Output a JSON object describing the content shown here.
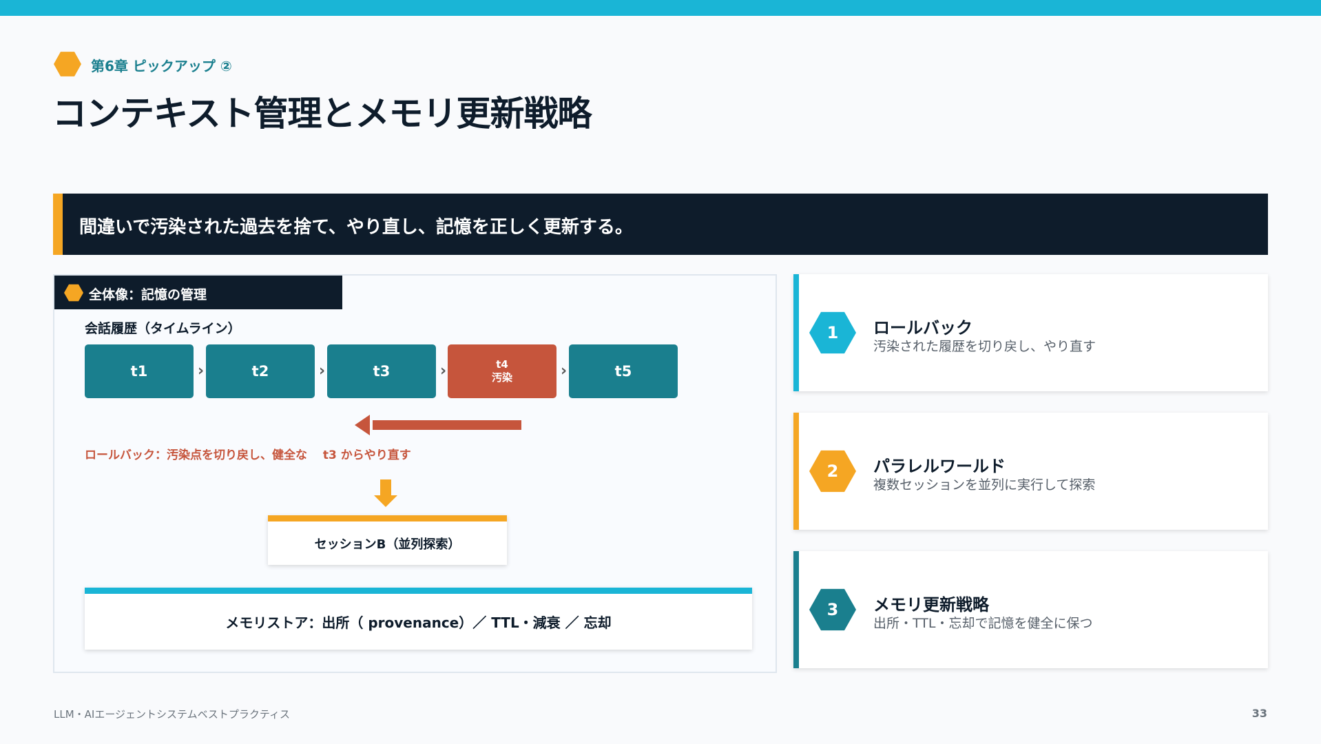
{
  "header": {
    "kicker": "第6章 ピックアップ ②",
    "title": "コンテキスト管理とメモリ更新戦略"
  },
  "banner": {
    "text": "間違いで汚染された過去を捨て、やり直し、記憶を正しく更新する。"
  },
  "panel": {
    "tab_label": "全体像：記憶の管理",
    "timeline_label": "会話履歴（タイムライン）",
    "timeline": [
      {
        "label": "t1"
      },
      {
        "label": "t2"
      },
      {
        "label": "t3"
      },
      {
        "label": "t4",
        "sub": "汚染"
      },
      {
        "label": "t5"
      }
    ],
    "chevron": "›",
    "rollback_text": "ロールバック：汚染点を切り戻し、健全な　 t3 からやり直す",
    "session_b": "セッションB（並列探索）",
    "memory_store": "メモリストア：出所（ provenance）／ TTL・減衰 ／ 忘却"
  },
  "cards": [
    {
      "number": "1",
      "title": "ロールバック",
      "desc": "汚染された履歴を切り戻し、やり直す",
      "color": "#1ab5d6"
    },
    {
      "number": "2",
      "title": "パラレルワールド",
      "desc": "複数セッションを並列に実行して探索",
      "color": "#f5a623"
    },
    {
      "number": "3",
      "title": "メモリ更新戦略",
      "desc": "出所・TTL・忘却で記憶を健全に保つ",
      "color": "#1a7f8e"
    }
  ],
  "footer": {
    "text": "LLM・AIエージェントシステムベストプラクティス",
    "page": "33"
  },
  "colors": {
    "accent_cyan": "#1ab5d6",
    "accent_orange": "#f5a623",
    "teal": "#1a7f8e",
    "red": "#c6553c",
    "navy": "#0e1c2b"
  }
}
